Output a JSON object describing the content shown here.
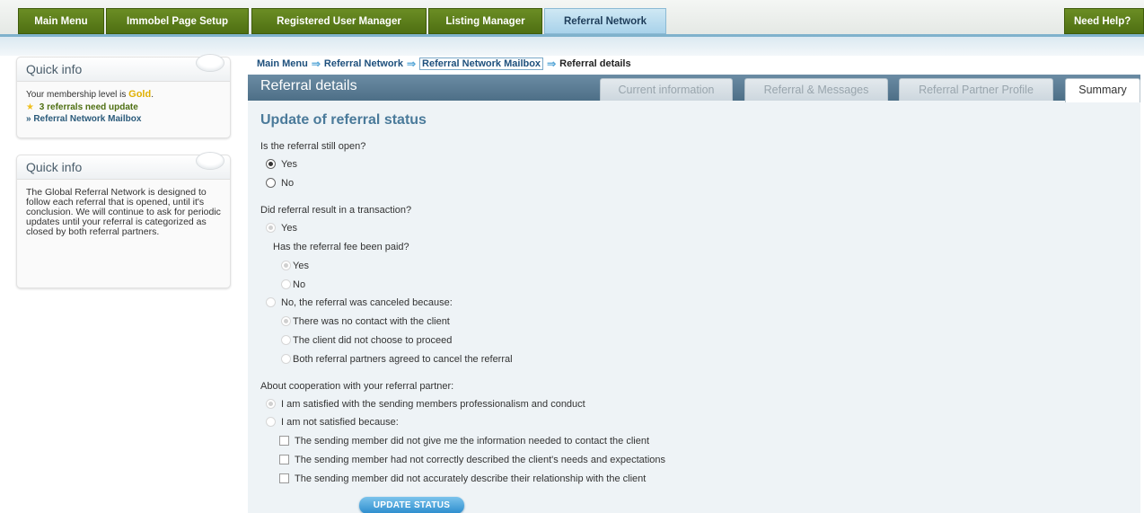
{
  "nav": {
    "main_menu": "Main Menu",
    "page_setup": "Immobel Page Setup",
    "user_manager": "Registered User Manager",
    "listing_manager": "Listing Manager",
    "referral_network": "Referral Network",
    "need_help": "Need Help?"
  },
  "sidebar": {
    "box1": {
      "title": "Quick info",
      "membership_prefix": "Your membership level is ",
      "membership_level": "Gold",
      "membership_suffix": ".",
      "alert": "3 referrals need update",
      "mailbox_link": "» Referral Network Mailbox"
    },
    "box2": {
      "title": "Quick info",
      "text": "The Global Referral Network is designed to follow each referral that is opened, until it's conclusion. We will continue to ask for periodic updates until your referral is categorized as closed by both referral partners."
    }
  },
  "breadcrumb": {
    "main_menu": "Main Menu",
    "referral_network": "Referral Network",
    "mailbox": "Referral Network Mailbox",
    "current": "Referral details",
    "separator": "⇒"
  },
  "panel": {
    "title": "Referral details",
    "tabs": {
      "current": "Current information",
      "messages": "Referral & Messages",
      "profile": "Referral Partner Profile",
      "summary": "Summary"
    }
  },
  "form": {
    "heading": "Update of referral status",
    "q_open": "Is the referral still open?",
    "open_yes": "Yes",
    "open_no": "No",
    "q_transaction": "Did referral result in a transaction?",
    "trans_yes": "Yes",
    "q_fee": "Has the referral fee been paid?",
    "fee_yes": "Yes",
    "fee_no": "No",
    "trans_no": "No, the referral was canceled because:",
    "cancel_1": "There was no contact with the client",
    "cancel_2": "The client did not choose to proceed",
    "cancel_3": "Both referral partners agreed to cancel the referral",
    "q_coop": "About cooperation with your referral partner:",
    "coop_satisfied": "I am satisfied with the sending members professionalism and conduct",
    "coop_not": "I am not satisfied because:",
    "reason_1": "The sending member did not give me the information needed to contact the client",
    "reason_2": "The sending member had not correctly described the client's needs and expectations",
    "reason_3": "The sending member did not accurately describe their relationship with the client",
    "submit": "UPDATE STATUS"
  }
}
